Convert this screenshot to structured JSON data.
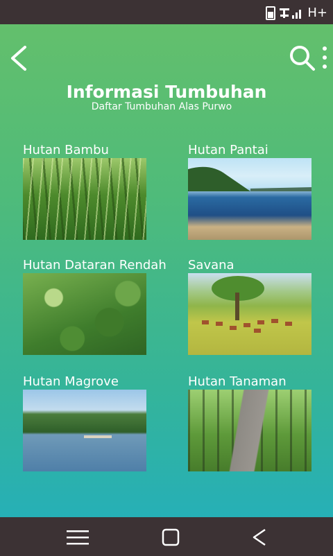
{
  "status_bar": {
    "network_type": "H+",
    "icons": [
      "battery-icon",
      "signal-icon"
    ]
  },
  "app_bar": {
    "back_icon": "chevron-left-icon",
    "search_icon": "search-icon",
    "more_icon": "more-vertical-icon"
  },
  "header": {
    "title": "Informasi Tumbuhan",
    "subtitle": "Daftar Tumbuhan Alas Purwo"
  },
  "cards": [
    {
      "label": "Hutan Bambu"
    },
    {
      "label": "Hutan Pantai"
    },
    {
      "label": "Hutan Dataran Rendah"
    },
    {
      "label": "Savana"
    },
    {
      "label": "Hutan Magrove"
    },
    {
      "label": "Hutan Tanaman"
    }
  ],
  "nav_bar": {
    "icons": [
      "menu-icon",
      "home-square-icon",
      "back-triangle-icon"
    ]
  },
  "colors": {
    "status_bar": "#3c3234",
    "gradient_top": "#66c06a",
    "gradient_bottom": "#22aebf",
    "text": "#ffffff"
  }
}
